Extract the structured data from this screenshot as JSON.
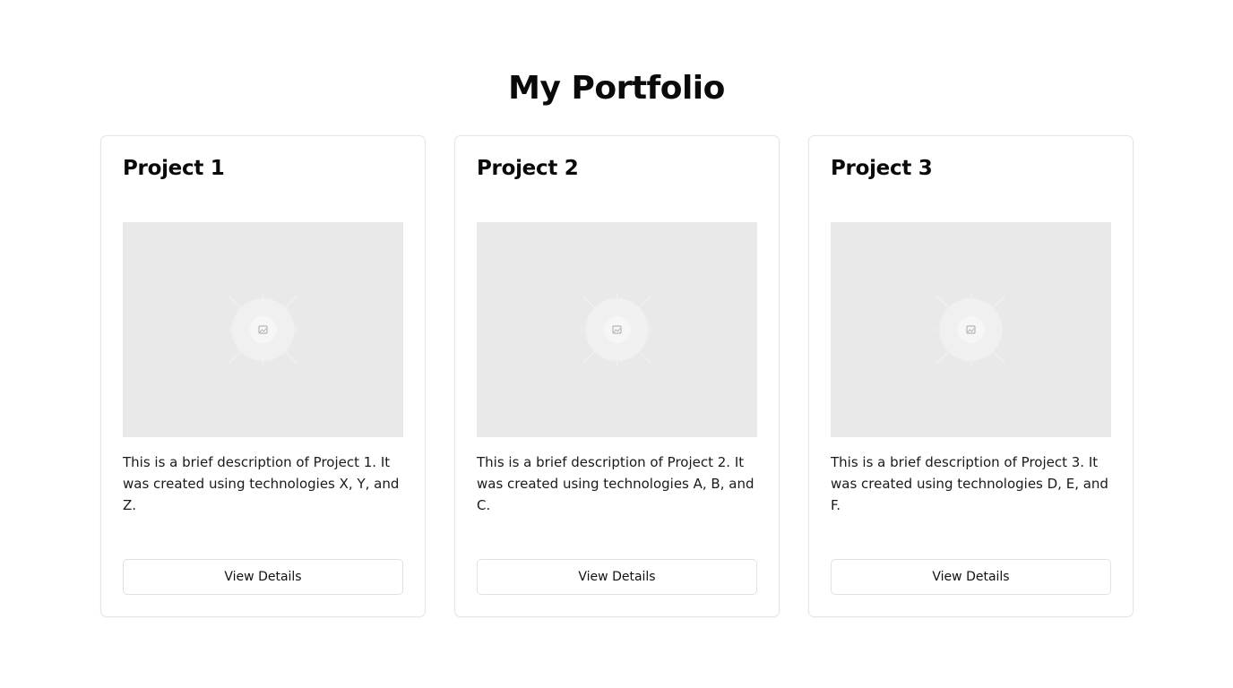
{
  "page": {
    "title": "My Portfolio"
  },
  "projects": [
    {
      "title": "Project 1",
      "description": "This is a brief description of Project 1. It was created using technologies X, Y, and Z.",
      "button_label": "View Details",
      "image_icon": "image-placeholder-icon"
    },
    {
      "title": "Project 2",
      "description": "This is a brief description of Project 2. It was created using technologies A, B, and C.",
      "button_label": "View Details",
      "image_icon": "image-placeholder-icon"
    },
    {
      "title": "Project 3",
      "description": "This is a brief description of Project 3. It was created using technologies D, E, and F.",
      "button_label": "View Details",
      "image_icon": "image-placeholder-icon"
    }
  ],
  "colors": {
    "background": "#ffffff",
    "card_border": "#e5e5e5",
    "image_placeholder": "#e9e9e9",
    "text": "#0a0a0a"
  }
}
